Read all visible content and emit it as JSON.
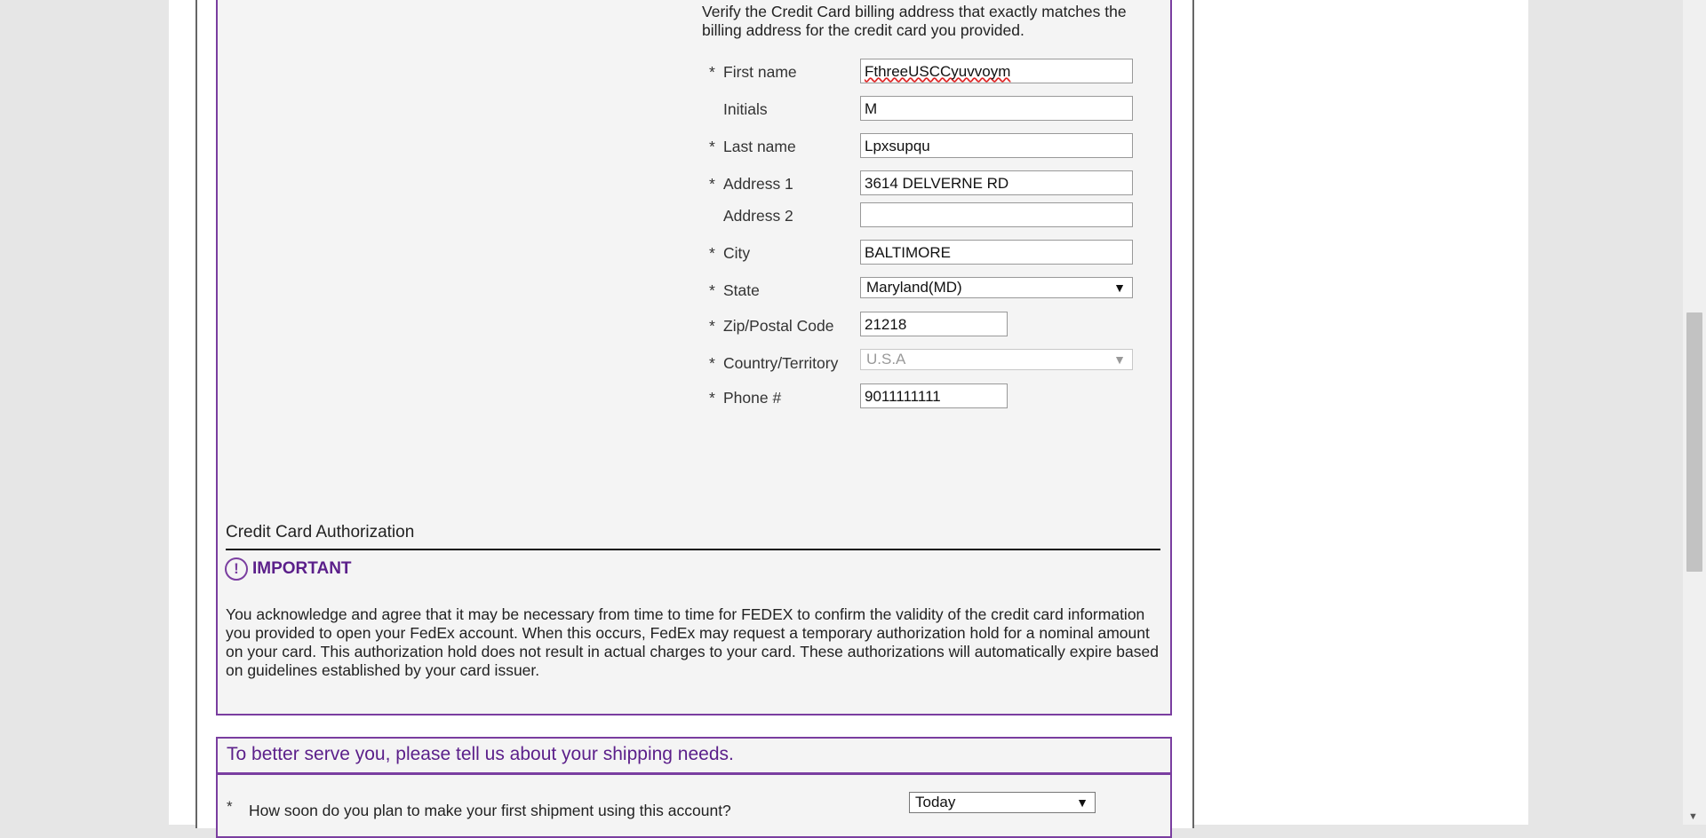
{
  "billing": {
    "intro": "Verify the Credit Card billing address that exactly matches the billing address for the credit card you provided.",
    "required_mark": "*",
    "fields": {
      "first_name": {
        "label": "First name",
        "value": "FthreeUSCCyuvvoym"
      },
      "initials": {
        "label": "Initials",
        "value": "M"
      },
      "last_name": {
        "label": "Last name",
        "value": "Lpxsupqu"
      },
      "address1": {
        "label": "Address 1",
        "value": "3614 DELVERNE RD"
      },
      "address2": {
        "label": "Address 2",
        "value": ""
      },
      "city": {
        "label": "City",
        "value": "BALTIMORE"
      },
      "state": {
        "label": "State",
        "value": "Maryland(MD)"
      },
      "zip": {
        "label": "Zip/Postal Code",
        "value": "21218"
      },
      "country": {
        "label": "Country/Territory",
        "value": "U.S.A"
      },
      "phone": {
        "label": "Phone #",
        "value": "9011111111"
      }
    }
  },
  "authorization": {
    "title": "Credit Card Authorization",
    "important_icon": "!",
    "important_label": "IMPORTANT",
    "body": "You acknowledge and agree that it may be necessary from time to time for FEDEX to confirm the validity of the credit card information you provided to open your FedEx account. When this occurs, FedEx may request a temporary authorization hold for a nominal amount on your card. This authorization hold does not result in actual charges to your card. These authorizations will automatically expire based on guidelines established by your card issuer."
  },
  "shipping": {
    "title": "To better serve you, please tell us about your shipping needs.",
    "required_mark": "*",
    "question": "How soon do you plan to make your first shipment using this account?",
    "answer": "Today"
  },
  "icons": {
    "dropdown_arrow": "▼",
    "scroll_down_arrow": "▼"
  },
  "colors": {
    "accent": "#7a3ea0",
    "accent_text": "#5b1f8a",
    "panel_bg": "#f4f4f4"
  }
}
